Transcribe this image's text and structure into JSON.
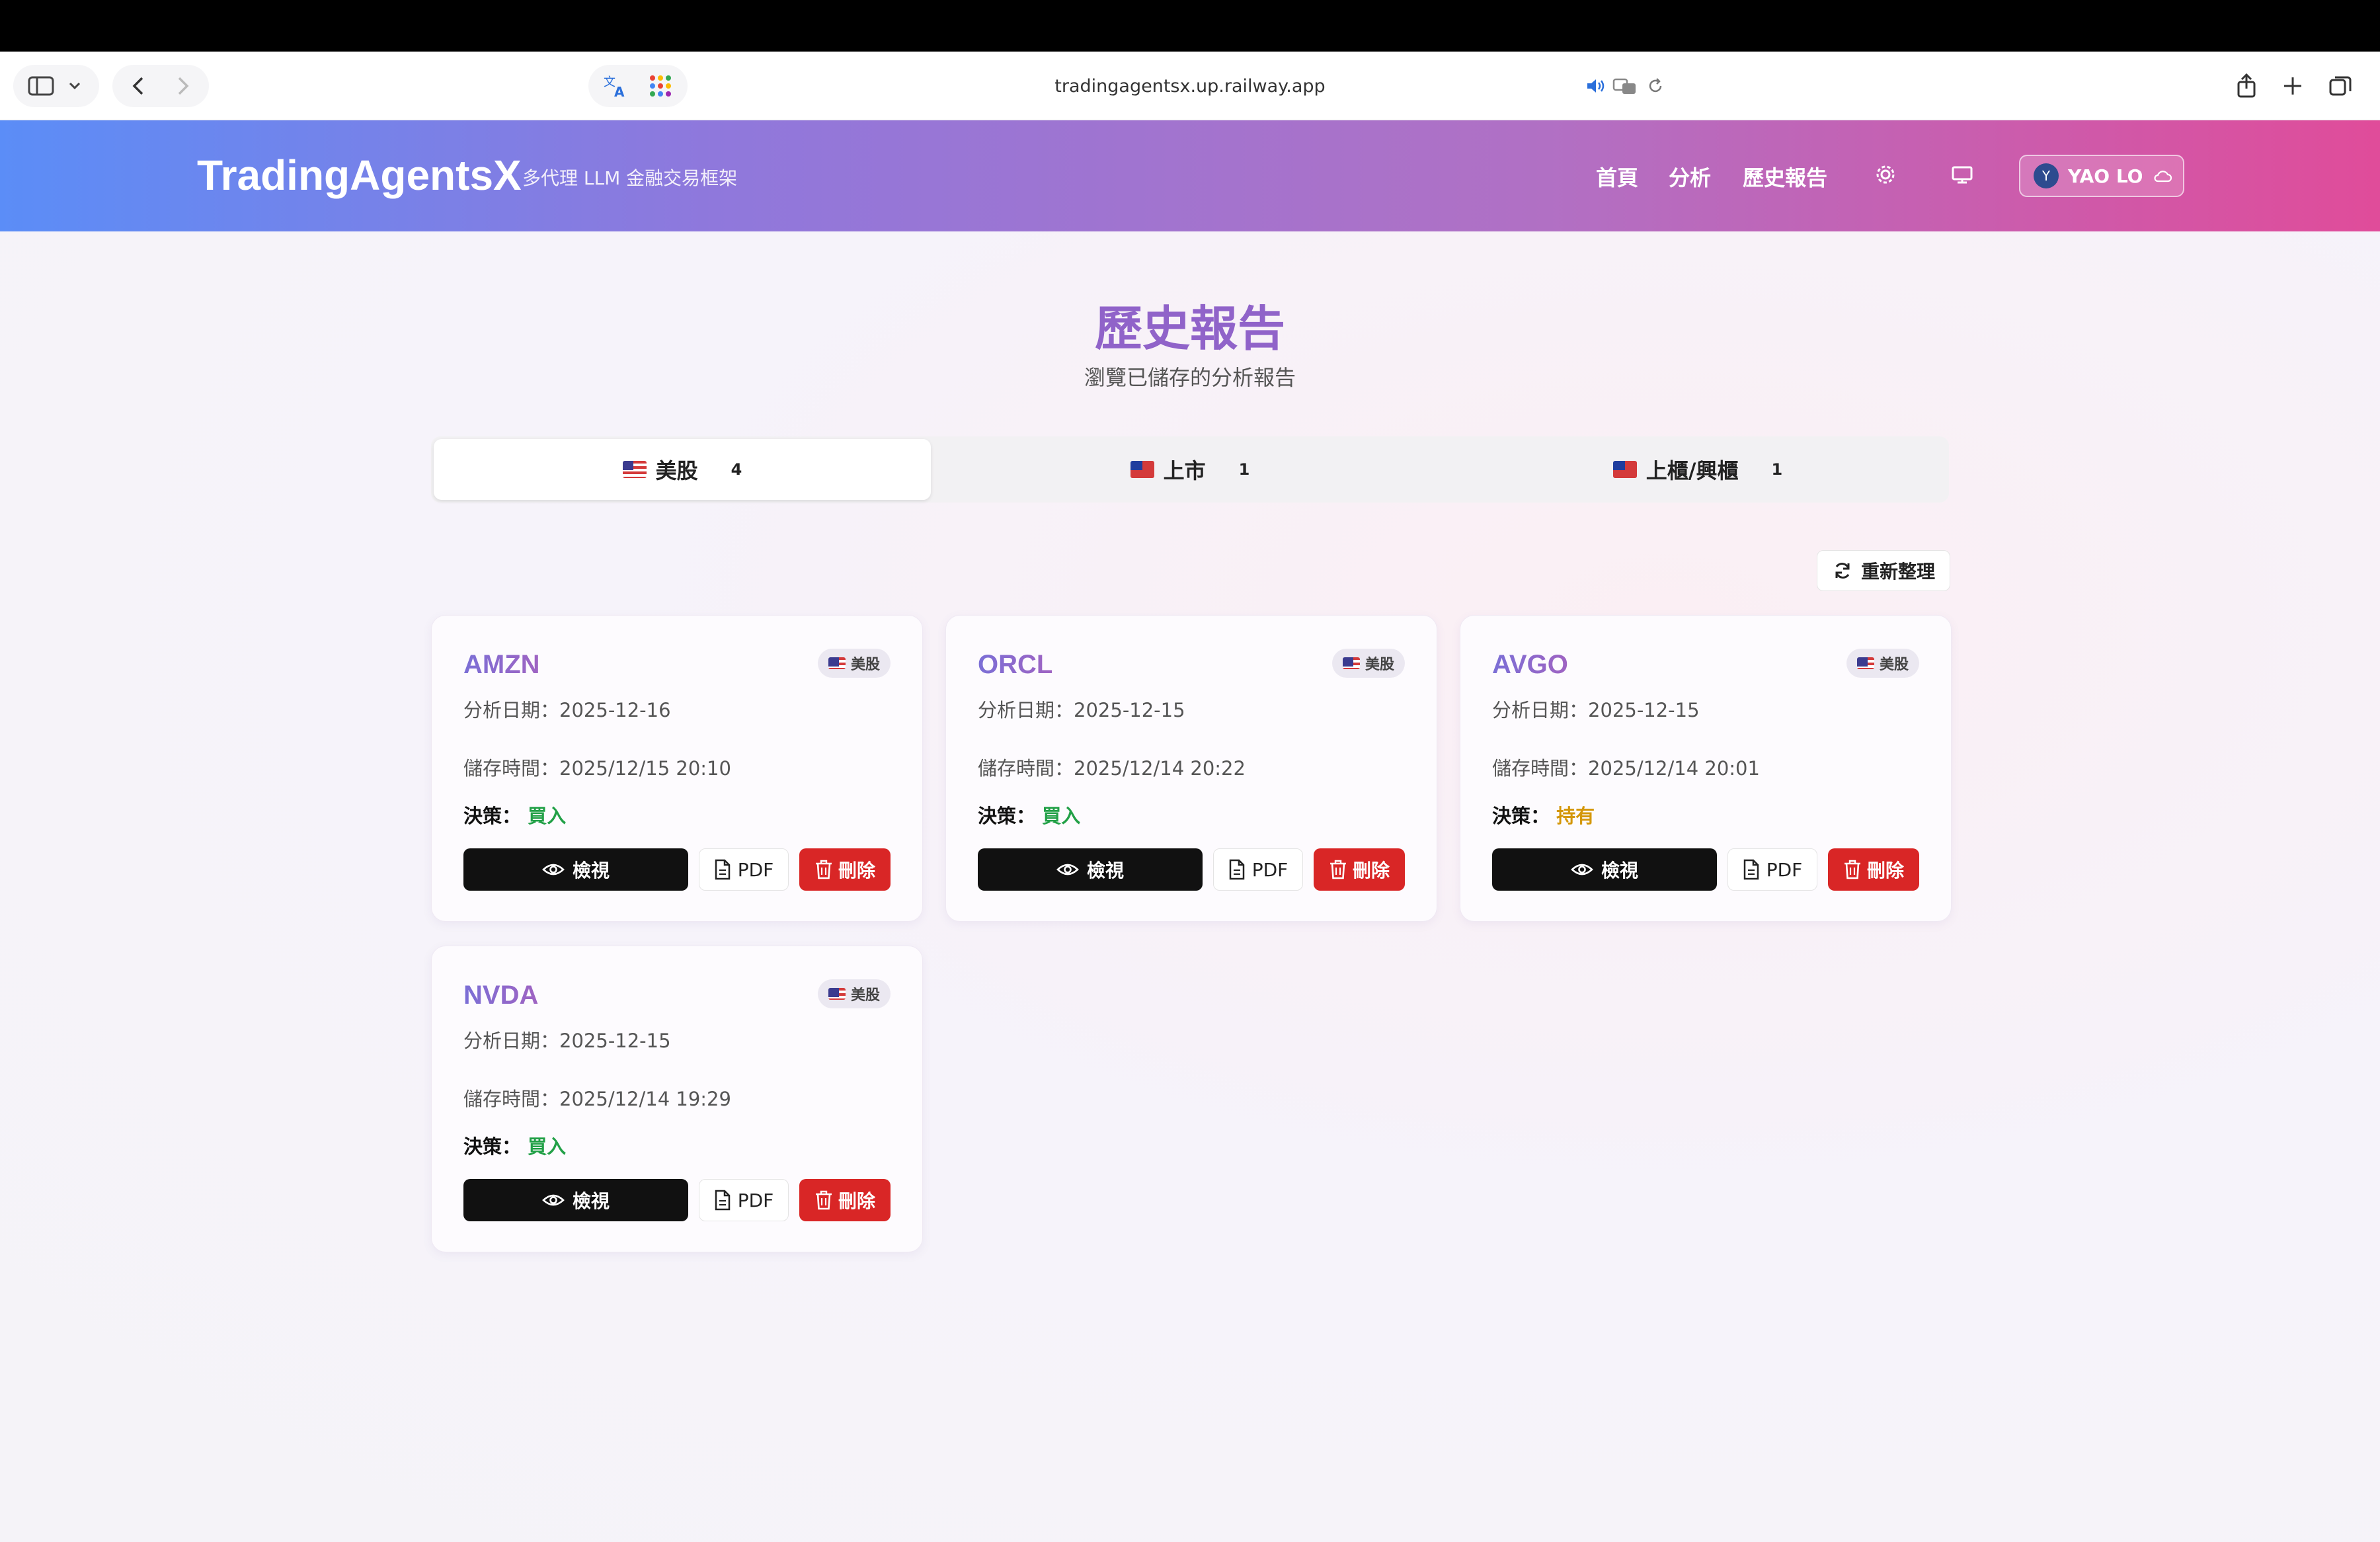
{
  "browser": {
    "url": "tradingagentsx.up.railway.app"
  },
  "header": {
    "brand": "TradingAgentsX",
    "tagline": "多代理 LLM 金融交易框架",
    "nav": {
      "home": "首頁",
      "analysis": "分析",
      "history": "歷史報告"
    },
    "user": {
      "initial": "Y",
      "name": "YAO LO"
    }
  },
  "page": {
    "title": "歷史報告",
    "subtitle": "瀏覽已儲存的分析報告"
  },
  "tabs": [
    {
      "label": "美股",
      "count": "4",
      "flag": "us",
      "active": true
    },
    {
      "label": "上市",
      "count": "1",
      "flag": "tw",
      "active": false
    },
    {
      "label": "上櫃/興櫃",
      "count": "1",
      "flag": "tw",
      "active": false
    }
  ],
  "refresh_label": "重新整理",
  "labels": {
    "analysis_date": "分析日期：",
    "saved_time": "儲存時間：",
    "decision": "決策：",
    "view": "檢視",
    "pdf": "PDF",
    "delete": "刪除"
  },
  "colors": {
    "buy": "#22a047",
    "hold": "#d4970a"
  },
  "reports": [
    {
      "ticker": "AMZN",
      "market": "美股",
      "analysis_date": "2025-12-16",
      "saved_time": "2025/12/15 20:10",
      "decision": "買入",
      "decision_type": "buy"
    },
    {
      "ticker": "ORCL",
      "market": "美股",
      "analysis_date": "2025-12-15",
      "saved_time": "2025/12/14 20:22",
      "decision": "買入",
      "decision_type": "buy"
    },
    {
      "ticker": "AVGO",
      "market": "美股",
      "analysis_date": "2025-12-15",
      "saved_time": "2025/12/14 20:01",
      "decision": "持有",
      "decision_type": "hold"
    },
    {
      "ticker": "NVDA",
      "market": "美股",
      "analysis_date": "2025-12-15",
      "saved_time": "2025/12/14 19:29",
      "decision": "買入",
      "decision_type": "buy"
    }
  ]
}
